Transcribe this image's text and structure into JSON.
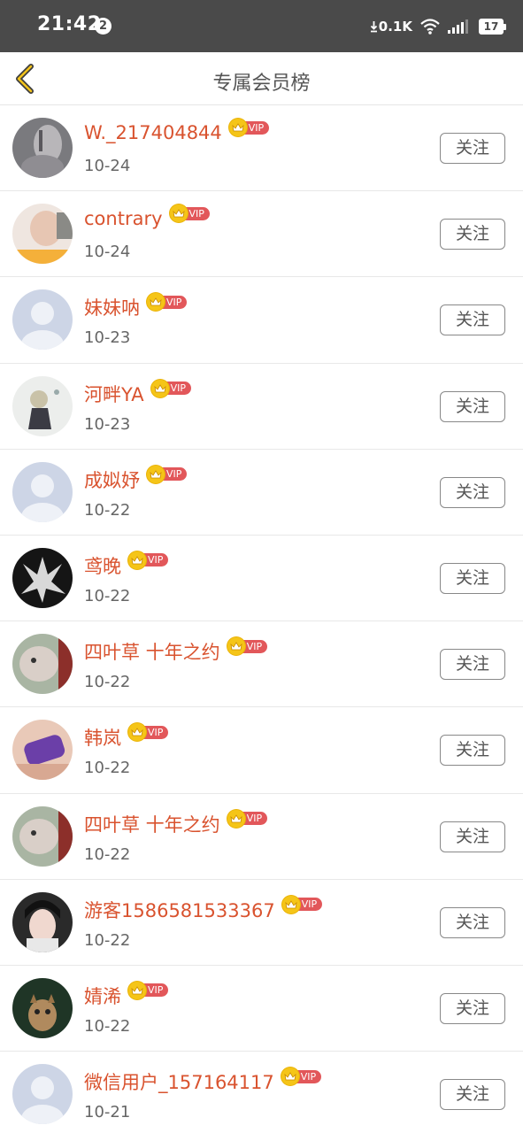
{
  "status_bar": {
    "time": "21:42",
    "notification_count": "2",
    "net_speed": "0.1K",
    "battery": "17"
  },
  "header": {
    "title": "专属会员榜"
  },
  "vip_label": "VIP",
  "follow_label": "关注",
  "members": [
    {
      "name": "W._217404844",
      "date": "10-24",
      "avatar": "photo"
    },
    {
      "name": "contrary",
      "date": "10-24",
      "avatar": "photo"
    },
    {
      "name": "妹妹呐",
      "date": "10-23",
      "avatar": "default"
    },
    {
      "name": "河畔YA",
      "date": "10-23",
      "avatar": "photo"
    },
    {
      "name": "成姒妤",
      "date": "10-22",
      "avatar": "default"
    },
    {
      "name": "鸢晚",
      "date": "10-22",
      "avatar": "photo"
    },
    {
      "name": "四叶草 十年之约",
      "date": "10-22",
      "avatar": "photo"
    },
    {
      "name": "韩岚",
      "date": "10-22",
      "avatar": "photo"
    },
    {
      "name": "四叶草 十年之约",
      "date": "10-22",
      "avatar": "photo"
    },
    {
      "name": "游客1586581533367",
      "date": "10-22",
      "avatar": "photo"
    },
    {
      "name": "婧浠",
      "date": "10-22",
      "avatar": "photo"
    },
    {
      "name": "微信用户_157164117",
      "date": "10-21",
      "avatar": "default"
    }
  ],
  "colors": {
    "status_bar_bg": "#4a4a4a",
    "name_color": "#d9532f",
    "vip_tag": "#e2575a",
    "crown": "#f5c518"
  }
}
